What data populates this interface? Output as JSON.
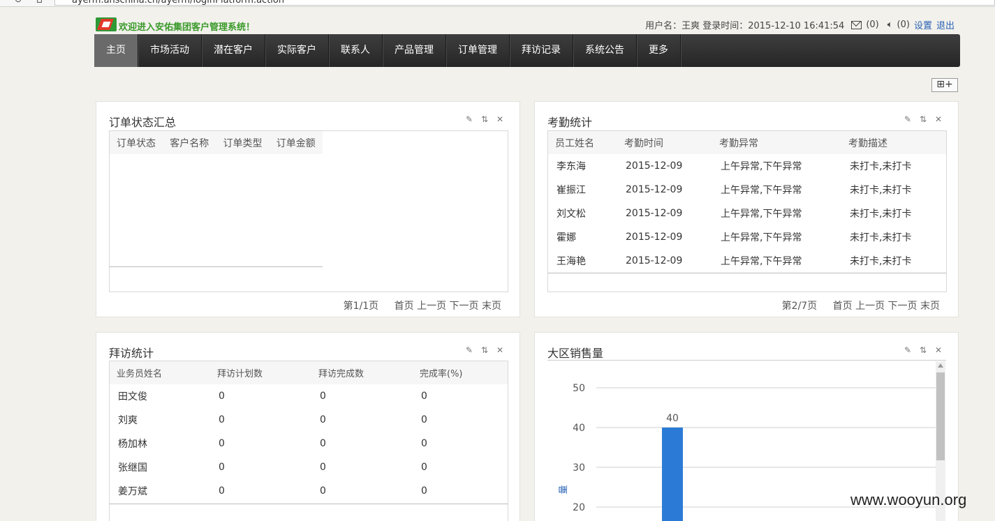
{
  "browser": {
    "url": "ayerm.anschina.cn/ayerm/loginPlatform.action"
  },
  "header": {
    "welcome": "欢迎进入安佑集团客户管理系统！",
    "user_text": "用户名：王爽 登录时间：2015-12-10 16:41:54",
    "mail_count": "(0)",
    "notice_count": "(0)",
    "settings": "设置",
    "logout": "退出"
  },
  "nav": [
    "主页",
    "市场活动",
    "潜在客户",
    "实际客户",
    "联系人",
    "产品管理",
    "订单管理",
    "拜访记录",
    "系统公告",
    "更多"
  ],
  "add_widget": "⊞+",
  "order_panel": {
    "title": "订单状态汇总",
    "columns": [
      "订单状态",
      "客户名称",
      "订单类型",
      "订单金额"
    ],
    "page_info": "第1/1页",
    "pager": [
      "首页",
      "上一页",
      "下一页",
      "末页"
    ]
  },
  "attendance_panel": {
    "title": "考勤统计",
    "columns": [
      "员工姓名",
      "考勤时间",
      "考勤异常",
      "考勤描述"
    ],
    "rows": [
      [
        "李东海",
        "2015-12-09",
        "上午异常,下午异常",
        "未打卡,未打卡"
      ],
      [
        "崔振江",
        "2015-12-09",
        "上午异常,下午异常",
        "未打卡,未打卡"
      ],
      [
        "刘文松",
        "2015-12-09",
        "上午异常,下午异常",
        "未打卡,未打卡"
      ],
      [
        "霍娜",
        "2015-12-09",
        "上午异常,下午异常",
        "未打卡,未打卡"
      ],
      [
        "王海艳",
        "2015-12-09",
        "上午异常,下午异常",
        "未打卡,未打卡"
      ]
    ],
    "page_info": "第2/7页",
    "pager": [
      "首页",
      "上一页",
      "下一页",
      "末页"
    ]
  },
  "visit_panel": {
    "title": "拜访统计",
    "columns": [
      "业务员姓名",
      "拜访计划数",
      "拜访完成数",
      "完成率(%)"
    ],
    "rows": [
      [
        "田文俊",
        "0",
        "0",
        "0"
      ],
      [
        "刘爽",
        "0",
        "0",
        "0"
      ],
      [
        "杨加林",
        "0",
        "0",
        "0"
      ],
      [
        "张继国",
        "0",
        "0",
        "0"
      ],
      [
        "姜万斌",
        "0",
        "0",
        "0"
      ]
    ]
  },
  "sales_panel": {
    "title": "大区销售量",
    "ylabel": "量",
    "color": "#2b7bd6"
  },
  "chart_data": {
    "type": "bar",
    "title": "大区销售量",
    "categories": [
      ""
    ],
    "values": [
      40
    ],
    "ylabel": "量",
    "ylim": [
      0,
      50
    ],
    "visible_ticks": [
      20,
      30,
      40,
      50
    ],
    "grid": true,
    "data_labels": true
  },
  "watermark": "www.wooyun.org"
}
